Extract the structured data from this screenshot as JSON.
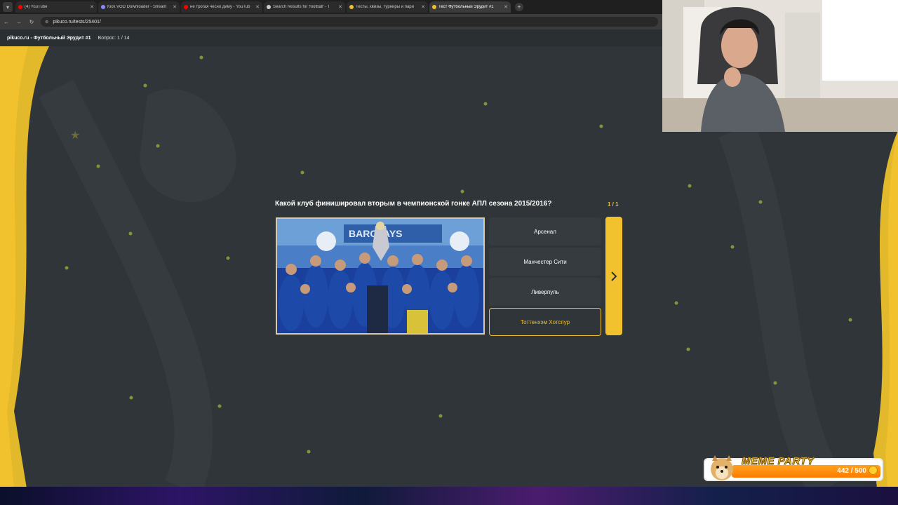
{
  "browser": {
    "tabs": [
      {
        "label": "(4) YouTube",
        "favicon_color": "#ff0000",
        "active": false
      },
      {
        "label": "Kick VOD Downloader - Stream",
        "favicon_color": "#8a8aff",
        "active": false
      },
      {
        "label": "не трогая чесно диму - YouTub",
        "favicon_color": "#ff0000",
        "active": false
      },
      {
        "label": "Search Results for 'football' - T",
        "favicon_color": "#cccccc",
        "active": false
      },
      {
        "label": "Тесты, квизы, турниры и пари",
        "favicon_color": "#f2c12e",
        "active": false
      },
      {
        "label": "Тест Футбольный Эрудит #1",
        "favicon_color": "#f2c12e",
        "active": true
      }
    ],
    "url": "pikuco.ru/tests/25401/"
  },
  "site": {
    "title": "pikuco.ru - Футбольный Эрудит #1",
    "question_counter": "Вопрос: 1 / 14"
  },
  "quiz": {
    "question": "Какой клуб финишировал вторым в чемпионской гонке АПЛ сезона 2015/2016?",
    "image_counter": "1 / 1",
    "answers": [
      {
        "label": "Арсенал",
        "selected": false
      },
      {
        "label": "Манчестер Сити",
        "selected": false
      },
      {
        "label": "Ливерпуль",
        "selected": false
      },
      {
        "label": "Тоттенхэм Хотспур",
        "selected": true
      }
    ],
    "accent_color": "#f2c12e"
  },
  "widget": {
    "title": "MEME PARTY",
    "count": "442 / 500",
    "progress": 0.884
  },
  "icons": {
    "next": "chevron-right-icon",
    "back": "arrow-left-icon",
    "forward": "arrow-right-icon",
    "reload": "reload-icon"
  }
}
